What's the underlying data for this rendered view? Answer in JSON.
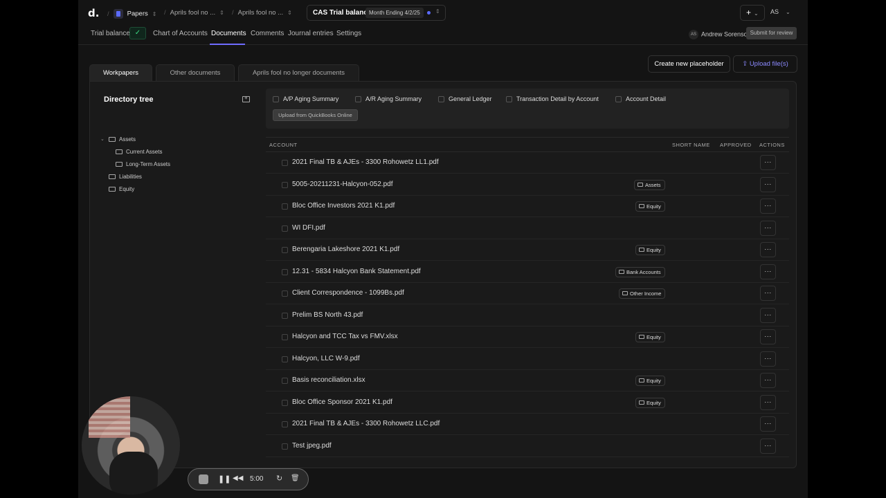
{
  "topbar": {
    "logo": "d.",
    "workspace": "Papers",
    "crumb1": "Aprils fool no ...",
    "crumb2": "Aprils fool no ...",
    "cas_title": "CAS Trial balance",
    "month_badge": "Month Ending 4/2/25",
    "plus": "+",
    "user_initials": "AS"
  },
  "nav": {
    "items": [
      "Trial balance",
      "Chart of Accounts",
      "Documents",
      "Comments",
      "Journal entries",
      "Settings"
    ],
    "active": "Documents",
    "reviewer_initials": "AS",
    "reviewer_name": "Andrew Sorenson",
    "submit_label": "Submit for review"
  },
  "doc_tabs": [
    "Workpapers",
    "Other documents",
    "Aprils fool no longer documents"
  ],
  "actions": {
    "create_label": "Create new placeholder",
    "upload_label": "Upload file(s)"
  },
  "directory": {
    "title": "Directory tree",
    "items": [
      {
        "label": "Assets"
      },
      {
        "label": "Current Assets"
      },
      {
        "label": "Long-Term Assets"
      },
      {
        "label": "Liabilities"
      },
      {
        "label": "Equity"
      }
    ]
  },
  "reports": {
    "items": [
      "A/P Aging Summary",
      "A/R Aging Summary",
      "General Ledger",
      "Transaction Detail by Account",
      "Account Detail"
    ],
    "upload_qb_label": "Upload from QuickBooks Online"
  },
  "table": {
    "headers": [
      "ACCOUNT",
      "SHORT NAME",
      "APPROVED",
      "ACTIONS"
    ],
    "rows": [
      {
        "name": "2021 Final TB & AJEs - 3300 Rohowetz LL1.pdf",
        "tag": ""
      },
      {
        "name": "5005-20211231-Halcyon-052.pdf",
        "tag": "Assets"
      },
      {
        "name": "Bloc Office Investors 2021 K1.pdf",
        "tag": "Equity"
      },
      {
        "name": "WI DFI.pdf",
        "tag": ""
      },
      {
        "name": "Berengaria Lakeshore 2021 K1.pdf",
        "tag": "Equity"
      },
      {
        "name": "12.31 - 5834 Halcyon Bank Statement.pdf",
        "tag": "Bank Accounts"
      },
      {
        "name": "Client Correspondence - 1099Bs.pdf",
        "tag": "Other Income"
      },
      {
        "name": "Prelim BS North 43.pdf",
        "tag": ""
      },
      {
        "name": "Halcyon and TCC Tax vs FMV.xlsx",
        "tag": "Equity"
      },
      {
        "name": "Halcyon, LLC W-9.pdf",
        "tag": ""
      },
      {
        "name": "Basis reconciliation.xlsx",
        "tag": "Equity"
      },
      {
        "name": "Bloc Office Sponsor 2021 K1.pdf",
        "tag": "Equity"
      },
      {
        "name": "2021 Final TB & AJEs - 3300 Rohowetz LLC.pdf",
        "tag": ""
      },
      {
        "name": "Test jpeg.pdf",
        "tag": ""
      }
    ],
    "action_label": "···"
  },
  "recorder": {
    "time": "5:00",
    "pause": "❚❚",
    "rewind": "◀◀",
    "restart": "↻",
    "trash": "🗑"
  },
  "colors": {
    "accent": "#6f6cff",
    "check_green": "#3ddc84",
    "background": "#141414"
  }
}
